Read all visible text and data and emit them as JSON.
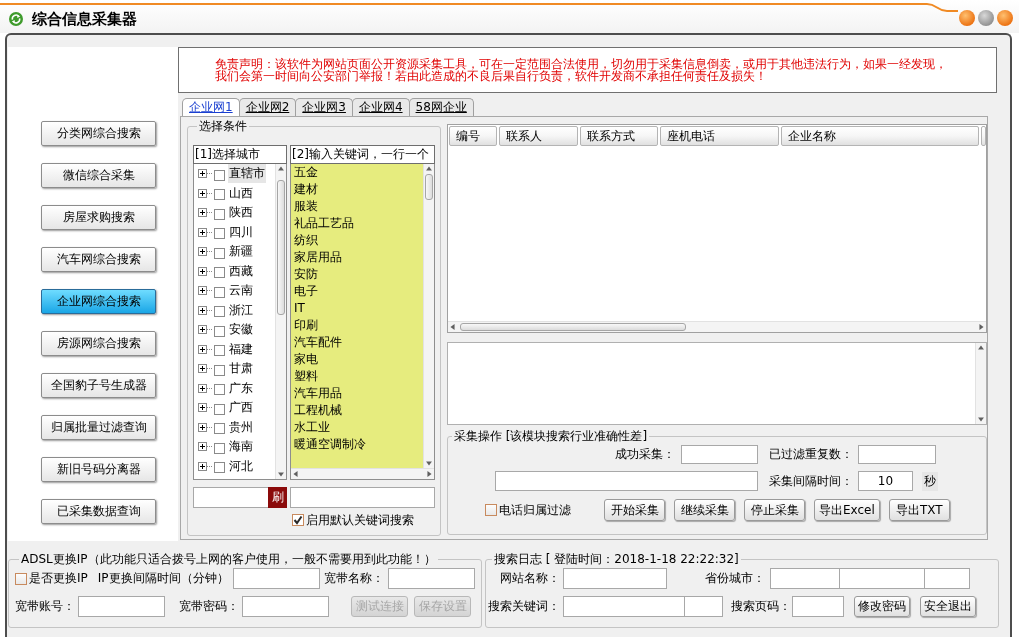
{
  "window": {
    "title": "综合信息采集器"
  },
  "sidebar": {
    "items": [
      {
        "label": "分类网综合搜索",
        "selected": false
      },
      {
        "label": "微信综合采集",
        "selected": false
      },
      {
        "label": "房屋求购搜索",
        "selected": false
      },
      {
        "label": "汽车网综合搜索",
        "selected": false
      },
      {
        "label": "企业网综合搜索",
        "selected": true
      },
      {
        "label": "房源网综合搜索",
        "selected": false
      },
      {
        "label": "全国豹子号生成器",
        "selected": false
      },
      {
        "label": "归属批量过滤查询",
        "selected": false
      },
      {
        "label": "新旧号码分离器",
        "selected": false
      },
      {
        "label": "已采集数据查询",
        "selected": false
      }
    ]
  },
  "disclaimer": {
    "lines": [
      "免责声明：该软件为网站页面公开资源采集工具，可在一定范围合法使用，切勿用于采集信息倒卖，或用于其他违法行为，如果一经发现，",
      "我们会第一时间向公安部门举报！若由此造成的不良后果自行负责，软件开发商不承担任何责任及损失！"
    ]
  },
  "tabs": [
    {
      "label": "企业网1",
      "selected": true
    },
    {
      "label": "企业网2",
      "selected": false
    },
    {
      "label": "企业网3",
      "selected": false
    },
    {
      "label": "企业网4",
      "selected": false
    },
    {
      "label": "58网企业",
      "selected": false
    }
  ],
  "conditions": {
    "title": "选择条件",
    "city_header": "[1]选择城市",
    "cities": [
      {
        "label": "直辖市",
        "expanded": false,
        "checked": false,
        "selected": true
      },
      {
        "label": "山西",
        "expanded": false,
        "checked": false,
        "selected": false
      },
      {
        "label": "陕西",
        "expanded": false,
        "checked": false,
        "selected": false
      },
      {
        "label": "四川",
        "expanded": false,
        "checked": false,
        "selected": false
      },
      {
        "label": "新疆",
        "expanded": false,
        "checked": false,
        "selected": false
      },
      {
        "label": "西藏",
        "expanded": false,
        "checked": false,
        "selected": false
      },
      {
        "label": "云南",
        "expanded": false,
        "checked": false,
        "selected": false
      },
      {
        "label": "浙江",
        "expanded": false,
        "checked": false,
        "selected": false
      },
      {
        "label": "安徽",
        "expanded": false,
        "checked": false,
        "selected": false
      },
      {
        "label": "福建",
        "expanded": false,
        "checked": false,
        "selected": false
      },
      {
        "label": "甘肃",
        "expanded": false,
        "checked": false,
        "selected": false
      },
      {
        "label": "广东",
        "expanded": false,
        "checked": false,
        "selected": false
      },
      {
        "label": "广西",
        "expanded": false,
        "checked": false,
        "selected": false
      },
      {
        "label": "贵州",
        "expanded": false,
        "checked": false,
        "selected": false
      },
      {
        "label": "海南",
        "expanded": false,
        "checked": false,
        "selected": false
      },
      {
        "label": "河北",
        "expanded": false,
        "checked": false,
        "selected": false
      }
    ],
    "keyword_header": "[2]输入关键词，一行一个",
    "keywords": [
      "五金",
      "建材",
      "服装",
      "礼品工艺品",
      "纺织",
      "家居用品",
      "安防",
      "电子",
      "IT",
      "印刷",
      "汽车配件",
      "家电",
      "塑料",
      "汽车用品",
      "工程机械",
      "水工业",
      "暖通空调制冷"
    ],
    "refresh_button": "刷",
    "default_keywords": {
      "label": "启用默认关键词搜索",
      "checked": true
    }
  },
  "table": {
    "columns": [
      "编号",
      "联系人",
      "联系方式",
      "座机电话",
      "企业名称"
    ]
  },
  "collect": {
    "title": "采集操作 [该模块搜索行业准确性差]",
    "success_label": "成功采集：",
    "filtered_label": "已过滤重复数：",
    "interval_label": "采集间隔时间：",
    "interval_value": "10",
    "interval_unit": "秒",
    "phone_filter": {
      "label": "电话归属过滤",
      "checked": false
    },
    "buttons": [
      "开始采集",
      "继续采集",
      "停止采集",
      "导出Excel",
      "导出TXT"
    ]
  },
  "adsl": {
    "title": "ADSL更换IP（此功能只适合拨号上网的客户使用，一般不需要用到此功能！）",
    "change_ip": {
      "label": "是否更换IP",
      "checked": false
    },
    "interval_label": "IP更换间隔时间（分钟）",
    "name_label": "宽带名称：",
    "account_label": "宽带账号：",
    "password_label": "宽带密码：",
    "buttons": [
      {
        "label": "测试连接",
        "disabled": true
      },
      {
        "label": "保存设置",
        "disabled": true
      }
    ]
  },
  "search_log": {
    "title": "搜索日志 [ 登陆时间：2018-1-18 22:22:32]",
    "site_label": "网站名称：",
    "province_label": "省份城市：",
    "keyword_label": "搜索关键词：",
    "page_label": "搜索页码：",
    "buttons": [
      "修改密码",
      "安全退出"
    ]
  }
}
